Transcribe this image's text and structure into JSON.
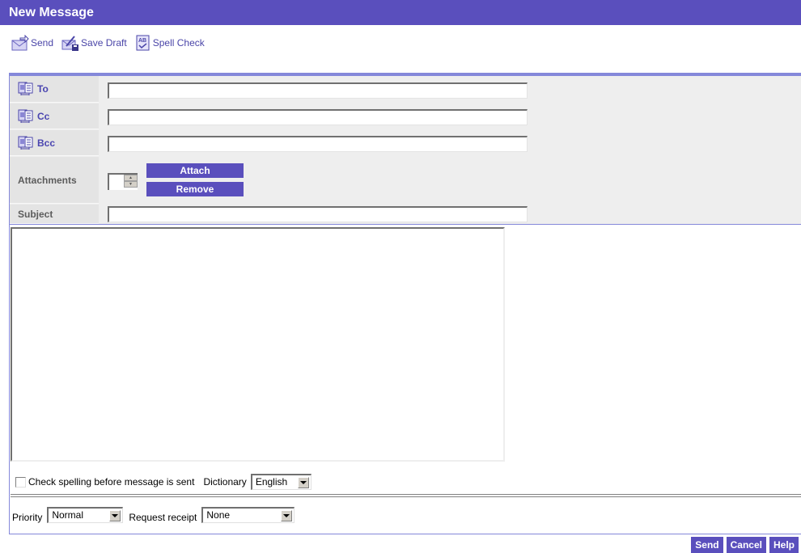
{
  "window": {
    "title": "New Message"
  },
  "toolbar": {
    "send_label": "Send",
    "save_draft_label": "Save Draft",
    "spell_check_label": "Spell Check"
  },
  "form": {
    "to": {
      "label": "To",
      "value": ""
    },
    "cc": {
      "label": "Cc",
      "value": ""
    },
    "bcc": {
      "label": "Bcc",
      "value": ""
    },
    "attachments": {
      "label": "Attachments",
      "attach_label": "Attach",
      "remove_label": "Remove"
    },
    "subject": {
      "label": "Subject",
      "value": ""
    },
    "body": {
      "value": ""
    }
  },
  "options": {
    "check_spelling_label": "Check spelling before message is sent",
    "check_spelling_checked": false,
    "dictionary_label": "Dictionary",
    "dictionary_value": "English",
    "priority_label": "Priority",
    "priority_value": "Normal",
    "receipt_label": "Request receipt",
    "receipt_value": "None"
  },
  "footer": {
    "send_label": "Send",
    "cancel_label": "Cancel",
    "help_label": "Help"
  },
  "colors": {
    "accent": "#5a4fbd",
    "panel_border": "#8488da",
    "panel_bg": "#eeeeee"
  }
}
